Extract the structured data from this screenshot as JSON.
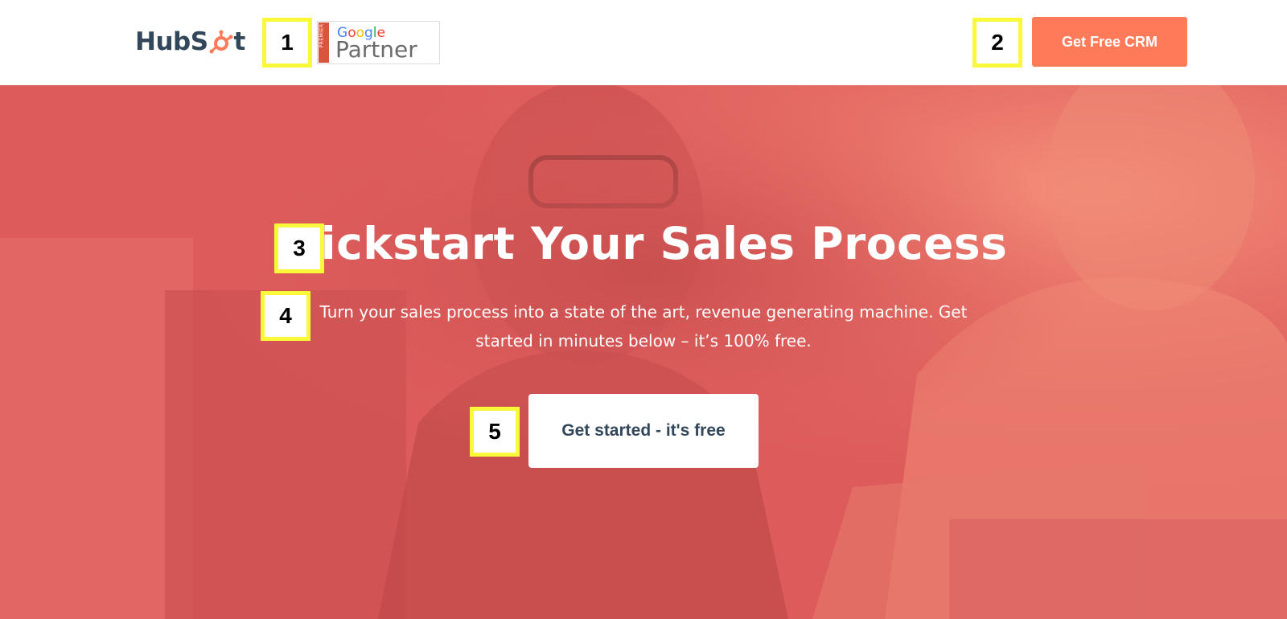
{
  "header": {
    "logo_text_left": "HubS",
    "logo_text_right": "t",
    "partner_badge": {
      "strip_label": "PREMIER",
      "google": [
        "G",
        "o",
        "o",
        "g",
        "l",
        "e"
      ],
      "partner": "Partner"
    },
    "cta_label": "Get Free CRM"
  },
  "hero": {
    "title": "Kickstart Your Sales Process",
    "subtitle_line1": "Turn your sales process into a state of the art, revenue generating machine. Get",
    "subtitle_line2": "started in minutes below – it’s 100% free.",
    "cta_label": "Get started - it's free"
  },
  "markers": [
    "1",
    "2",
    "3",
    "4",
    "5"
  ],
  "colors": {
    "brand_orange": "#ff7a59",
    "hero_overlay": "#dd5c5b",
    "text_dark": "#33475b",
    "marker_yellow": "#f9f93a",
    "google_blue": "#4285f4",
    "google_red": "#ea4335",
    "google_yellow": "#fbbc05",
    "google_green": "#34a853"
  },
  "icons": {
    "logo_sprocket": "hubspot-sprocket-icon",
    "hero_background": "office-people-photo"
  }
}
